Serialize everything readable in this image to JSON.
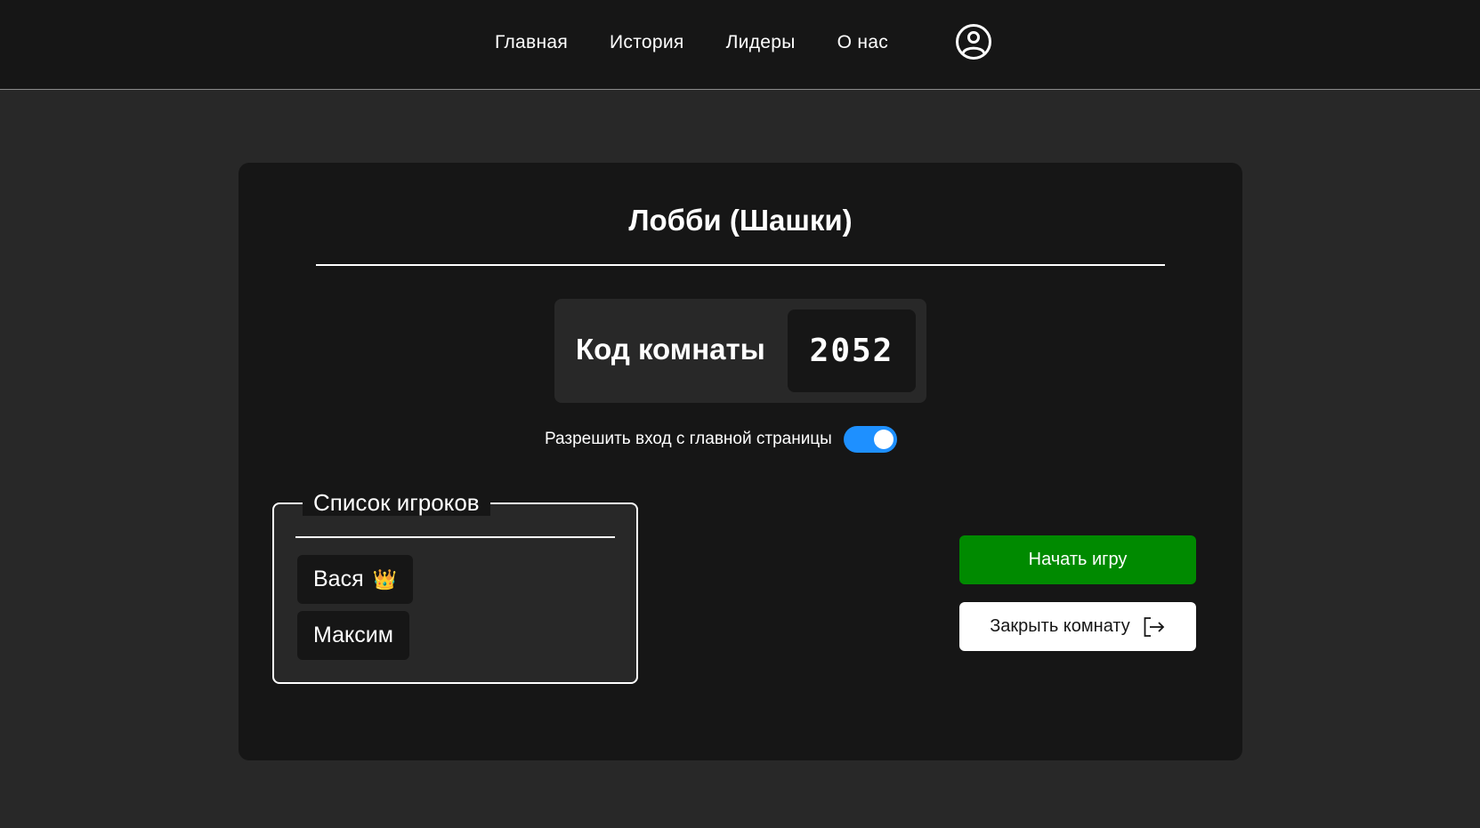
{
  "nav": {
    "links": [
      {
        "label": "Главная"
      },
      {
        "label": "История"
      },
      {
        "label": "Лидеры"
      },
      {
        "label": "О нас"
      }
    ],
    "profile_icon": "user-circle-icon"
  },
  "lobby": {
    "title": "Лобби (Шашки)",
    "room_code_label": "Код комнаты",
    "room_code": "2052",
    "toggle_label": "Разрешить вход с главной страницы",
    "toggle_on": true,
    "accent_color": "#1e90ff",
    "players_title": "Список игроков",
    "players": [
      {
        "name": "Вася",
        "host": true,
        "icon": "crown-icon"
      },
      {
        "name": "Максим",
        "host": false
      }
    ],
    "start_button": "Начать игру",
    "start_button_color": "#008a00",
    "close_button": "Закрыть комнату",
    "close_icon": "exit-icon"
  }
}
